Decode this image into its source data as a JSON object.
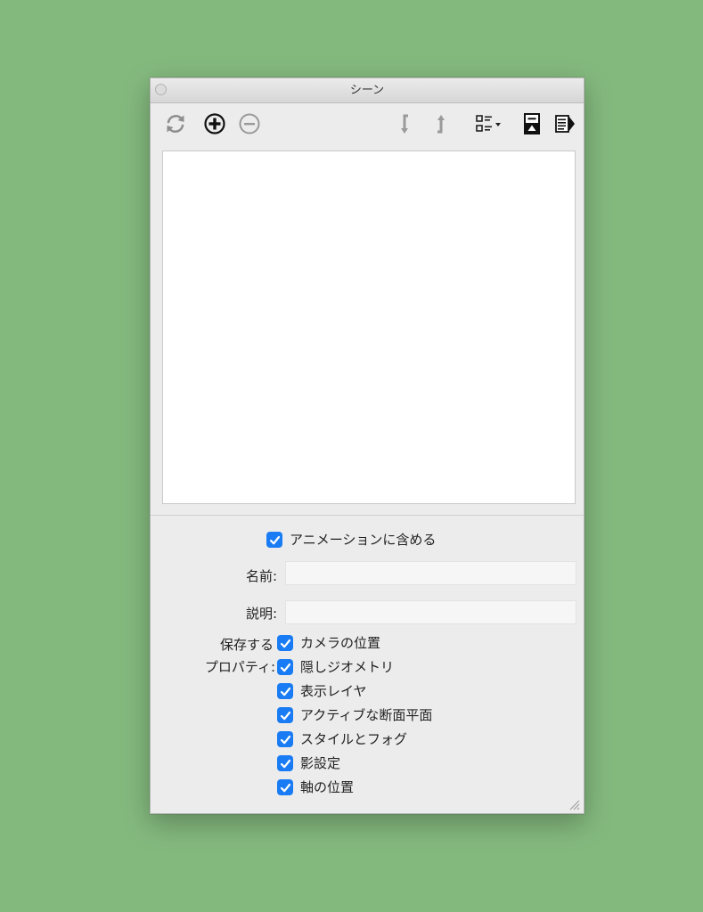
{
  "window": {
    "title": "シーン"
  },
  "toolbar": {
    "icons": [
      "refresh-icon",
      "add-scene-icon",
      "remove-scene-icon",
      "move-down-icon",
      "move-up-icon",
      "view-options-icon",
      "details-panel-icon",
      "export-icon"
    ]
  },
  "options": {
    "include_in_animation": {
      "label": "アニメーションに含める",
      "checked": true
    },
    "name_label": "名前:",
    "name_value": "",
    "description_label": "説明:",
    "description_value": "",
    "properties_label_line1": "保存する",
    "properties_label_line2": "プロパティ:",
    "properties": [
      {
        "label": "カメラの位置",
        "checked": true
      },
      {
        "label": "隠しジオメトリ",
        "checked": true
      },
      {
        "label": "表示レイヤ",
        "checked": true
      },
      {
        "label": "アクティブな断面平面",
        "checked": true
      },
      {
        "label": "スタイルとフォグ",
        "checked": true
      },
      {
        "label": "影設定",
        "checked": true
      },
      {
        "label": "軸の位置",
        "checked": true
      }
    ]
  },
  "colors": {
    "background": "#84b97e",
    "checkbox": "#1a7cf4",
    "window": "#ececec"
  }
}
